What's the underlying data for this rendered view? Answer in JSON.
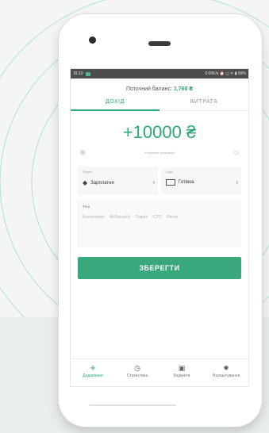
{
  "status_bar": {
    "time": "16:10",
    "right": "0.00K/s ⏰ ◻ ᯤ ▮ 69%"
  },
  "balance": {
    "label": "Поточний баланс:",
    "value": "1,760 ₴"
  },
  "tabs": [
    {
      "label": "ДОХІД",
      "active": true
    },
    {
      "label": "ВИТРАТА",
      "active": false
    }
  ],
  "amount": "+10000 ₴",
  "comment": {
    "placeholder": "Коментар транзакції",
    "left_icon": "calendar-icon",
    "right_icon": "clock-icon"
  },
  "category": {
    "caption": "Звідки",
    "value": "Зарплатня",
    "icon": "tag-icon"
  },
  "wallet": {
    "caption": "Куди",
    "value": "Готівка",
    "icon": "wallet-icon"
  },
  "tags": {
    "caption": "Теги",
    "items": [
      "Бухгалтерія",
      "McDonald's",
      "Таврія",
      "СТО",
      "Ринок"
    ]
  },
  "save_button": "ЗБЕРЕГТИ",
  "bottom_nav": [
    {
      "label": "Додавання",
      "icon": "plus-icon",
      "active": true
    },
    {
      "label": "Статистика",
      "icon": "clock-icon",
      "active": false
    },
    {
      "label": "Бюджети",
      "icon": "wallet-icon",
      "active": false
    },
    {
      "label": "Налаштування",
      "icon": "gear-icon",
      "active": false
    }
  ],
  "colors": {
    "accent": "#2aa876",
    "button": "#39a87d",
    "status_bar": "#4d4d4d"
  }
}
